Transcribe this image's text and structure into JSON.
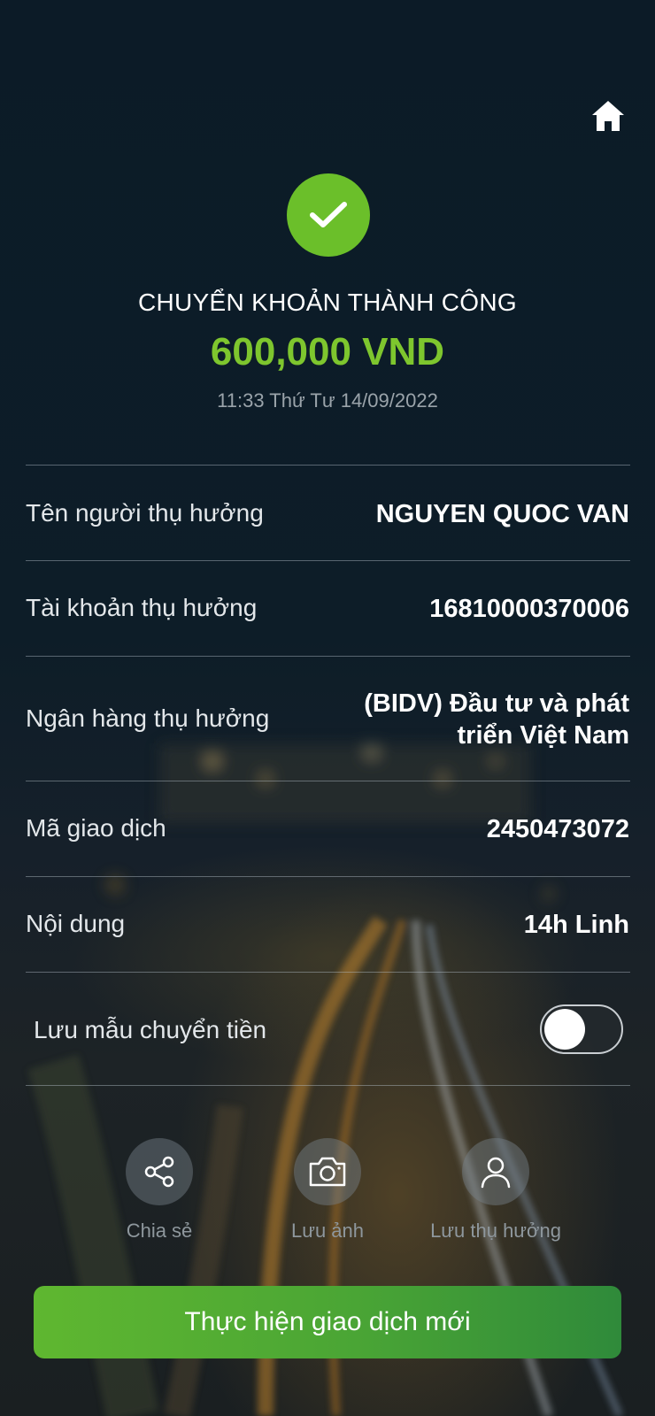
{
  "header": {
    "home_icon": "home-icon"
  },
  "status": {
    "icon": "check-icon",
    "title": "CHUYỂN KHOẢN THÀNH CÔNG",
    "amount": "600,000 VND",
    "datetime": "11:33 Thứ Tư 14/09/2022"
  },
  "details": [
    {
      "label": "Tên người thụ hưởng",
      "value": "NGUYEN QUOC VAN"
    },
    {
      "label": "Tài khoản thụ hưởng",
      "value": "16810000370006"
    },
    {
      "label": "Ngân hàng thụ hưởng",
      "value_line1": "(BIDV) Đầu tư và phát",
      "value_line2": "triển Việt Nam"
    },
    {
      "label": "Mã giao dịch",
      "value": "2450473072"
    },
    {
      "label": "Nội dung",
      "value": "14h Linh"
    }
  ],
  "save_template": {
    "label": "Lưu mẫu chuyển tiền",
    "enabled": false
  },
  "actions": [
    {
      "label": "Chia sẻ",
      "icon": "share-icon"
    },
    {
      "label": "Lưu ảnh",
      "icon": "camera-icon"
    },
    {
      "label": "Lưu thụ hưởng",
      "icon": "user-icon"
    }
  ],
  "cta": {
    "label": "Thực hiện giao dịch mới"
  },
  "colors": {
    "accent_green": "#6bbf2a",
    "amount_green": "#7ec62e",
    "background_dark": "#0c1b27"
  }
}
